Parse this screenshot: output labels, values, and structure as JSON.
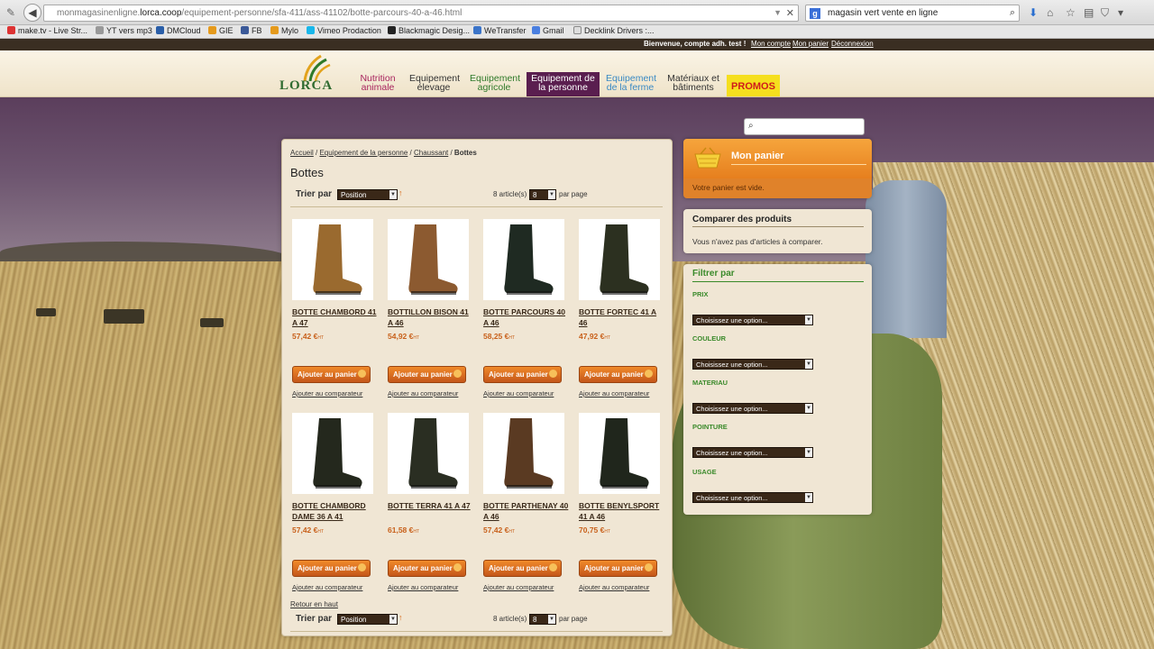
{
  "browser": {
    "url_prefix": "monmagasinenligne.",
    "url_host": "lorca.coop",
    "url_path": "/equipement-personne/sfa-411/ass-41102/botte-parcours-40-a-46.html",
    "search_engine_badge": "g",
    "search_query": "magasin vert vente en ligne",
    "bookmarks": [
      "make.tv - Live Str...",
      "YT vers mp3",
      "DMCloud",
      "GIE",
      "FB",
      "Mylo",
      "Vimeo Prodaction",
      "Blackmagic Desig...",
      "WeTransfer",
      "Gmail",
      "Decklink Drivers :..."
    ]
  },
  "account_bar": {
    "welcome": "Bienvenue, compte adh. test !",
    "my_account": "Mon compte",
    "my_cart": "Mon panier",
    "logout": "Déconnexion"
  },
  "header": {
    "logo_text": "LORCA",
    "nav": [
      {
        "line1": "Nutrition",
        "line2": "animale",
        "color": "#a8245e"
      },
      {
        "line1": "Equipement",
        "line2": "élevage",
        "color": "#333333"
      },
      {
        "line1": "Equipement",
        "line2": "agricole",
        "color": "#2f7a2a"
      },
      {
        "line1": "Equipement de",
        "line2": "la personne",
        "color": "#ffffff"
      },
      {
        "line1": "Equipement",
        "line2": "de la ferme",
        "color": "#3a8ac4"
      },
      {
        "line1": "Matériaux et",
        "line2": "bâtiments",
        "color": "#333333"
      }
    ],
    "promos": "PROMOS"
  },
  "main": {
    "breadcrumb": {
      "home": "Accueil",
      "sep1": " / ",
      "cat1": "Equipement de la personne",
      "sep2": " / ",
      "cat2": "Chaussant",
      "sep3": " / ",
      "current": "Bottes"
    },
    "title": "Bottes",
    "sort_label": "Trier par",
    "sort_value": "Position",
    "sort_dir": "↑",
    "count": "8 article(s)",
    "per_page_value": "8",
    "per_page_label": "par page",
    "add_to_cart": "Ajouter au panier",
    "add_to_compare": "Ajouter au comparateur",
    "back_to_top": "Retour en haut",
    "price_suffix": "HT",
    "products": [
      {
        "name": "BOTTE CHAMBORD 41 A 47",
        "price": "57,42 €",
        "boot_color": "#9a6a2f"
      },
      {
        "name": "BOTTILLON BISON 41 A 46",
        "price": "54,92 €",
        "boot_color": "#8c5a30"
      },
      {
        "name": "BOTTE PARCOURS 40 A 46",
        "price": "58,25 €",
        "boot_color": "#1f2a22"
      },
      {
        "name": "BOTTE FORTEC 41 A 46",
        "price": "47,92 €",
        "boot_color": "#2c3020"
      },
      {
        "name": "BOTTE CHAMBORD DAME 36 A 41",
        "price": "57,42 €",
        "boot_color": "#24281d"
      },
      {
        "name": "BOTTE TERRA 41 A 47",
        "price": "61,58 €",
        "boot_color": "#2a2e22"
      },
      {
        "name": "BOTTE PARTHENAY 40 A 46",
        "price": "57,42 €",
        "boot_color": "#5a3a22"
      },
      {
        "name": "BOTTE BENYLSPORT 41 A 46",
        "price": "70,75 €",
        "boot_color": "#20261c"
      }
    ]
  },
  "sidebar": {
    "search_placeholder": "",
    "cart_title": "Mon panier",
    "cart_empty": "Votre panier est vide.",
    "compare_title": "Comparer des produits",
    "compare_empty": "Vous n'avez pas d'articles à comparer.",
    "filter_title": "Filtrer par",
    "filters": [
      {
        "label": "PRIX",
        "option": "Choisissez une option..."
      },
      {
        "label": "COULEUR",
        "option": "Choisissez une option..."
      },
      {
        "label": "MATERIAU",
        "option": "Choisissez une option..."
      },
      {
        "label": "POINTURE",
        "option": "Choisissez une option..."
      },
      {
        "label": "USAGE",
        "option": "Choisissez une option..."
      }
    ]
  }
}
